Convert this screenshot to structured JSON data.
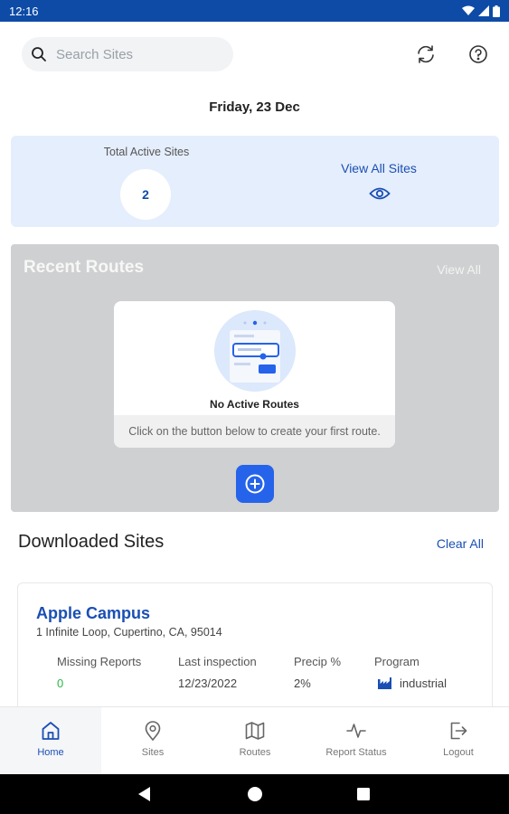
{
  "status_bar": {
    "time": "12:16"
  },
  "search": {
    "placeholder": "Search Sites"
  },
  "date_label": "Friday, 23 Dec",
  "summary": {
    "total_label": "Total Active Sites",
    "total_value": "2",
    "view_all_label": "View All Sites"
  },
  "recent_routes": {
    "title": "Recent Routes",
    "view_all_label": "View All",
    "empty_title": "No Active Routes",
    "empty_hint": "Click on the button below to create your first route."
  },
  "downloaded_sites": {
    "title": "Downloaded Sites",
    "clear_all_label": "Clear All",
    "sites": [
      {
        "name": "Apple Campus",
        "address": "1 Infinite Loop, Cupertino, CA, 95014",
        "columns": [
          {
            "header": "Missing Reports",
            "value": "0"
          },
          {
            "header": "Last inspection",
            "value": "12/23/2022"
          },
          {
            "header": "Precip %",
            "value": "2%"
          },
          {
            "header": "Program",
            "value": "industrial"
          }
        ]
      }
    ]
  },
  "nav": [
    {
      "label": "Home",
      "icon": "home-icon",
      "active": true
    },
    {
      "label": "Sites",
      "icon": "location-pin-icon",
      "active": false
    },
    {
      "label": "Routes",
      "icon": "map-icon",
      "active": false
    },
    {
      "label": "Report Status",
      "icon": "activity-icon",
      "active": false
    },
    {
      "label": "Logout",
      "icon": "logout-icon",
      "active": false
    }
  ],
  "colors": {
    "accent": "#1a4fb3",
    "status_bar": "#0d4ba6",
    "summary_bg": "#e5eefc",
    "routes_bg": "#cfd0d1",
    "add_button": "#2563eb",
    "success": "#2fb34a"
  }
}
